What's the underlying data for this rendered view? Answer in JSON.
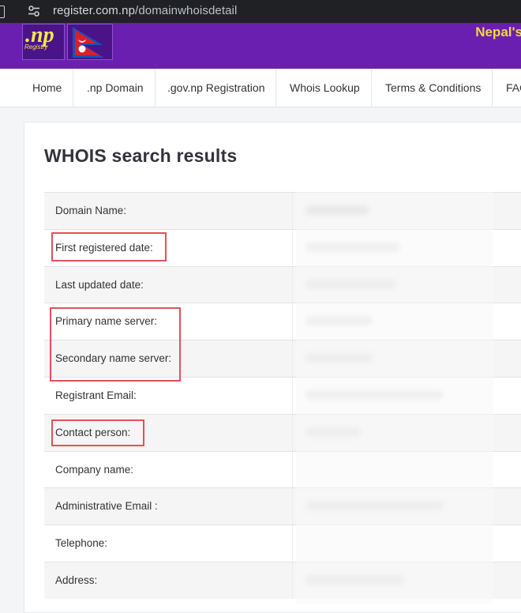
{
  "browser": {
    "url_host": "register.com.np",
    "url_path": "/domainwhoisdetail"
  },
  "header": {
    "logo_text": ".np",
    "logo_subtext": "Registry",
    "tagline": "Nepal's"
  },
  "nav": {
    "items": [
      {
        "label": "Home"
      },
      {
        "label": ".np Domain"
      },
      {
        "label": ".gov.np Registration"
      },
      {
        "label": "Whois Lookup"
      },
      {
        "label": "Terms & Conditions"
      },
      {
        "label": "FAQ"
      }
    ]
  },
  "page": {
    "title": "WHOIS search results"
  },
  "whois": {
    "rows": [
      {
        "label": "Domain Name:"
      },
      {
        "label": "First registered date:"
      },
      {
        "label": "Last updated date:"
      },
      {
        "label": "Primary name server:"
      },
      {
        "label": "Secondary name server:"
      },
      {
        "label": "Registrant Email:"
      },
      {
        "label": "Contact person:"
      },
      {
        "label": "Company name:"
      },
      {
        "label": "Administrative Email :"
      },
      {
        "label": "Telephone:"
      },
      {
        "label": "Address:"
      }
    ]
  },
  "colors": {
    "header_bg": "#6a1fb0",
    "highlight": "#e0525a",
    "tagline": "#f3d83a"
  }
}
